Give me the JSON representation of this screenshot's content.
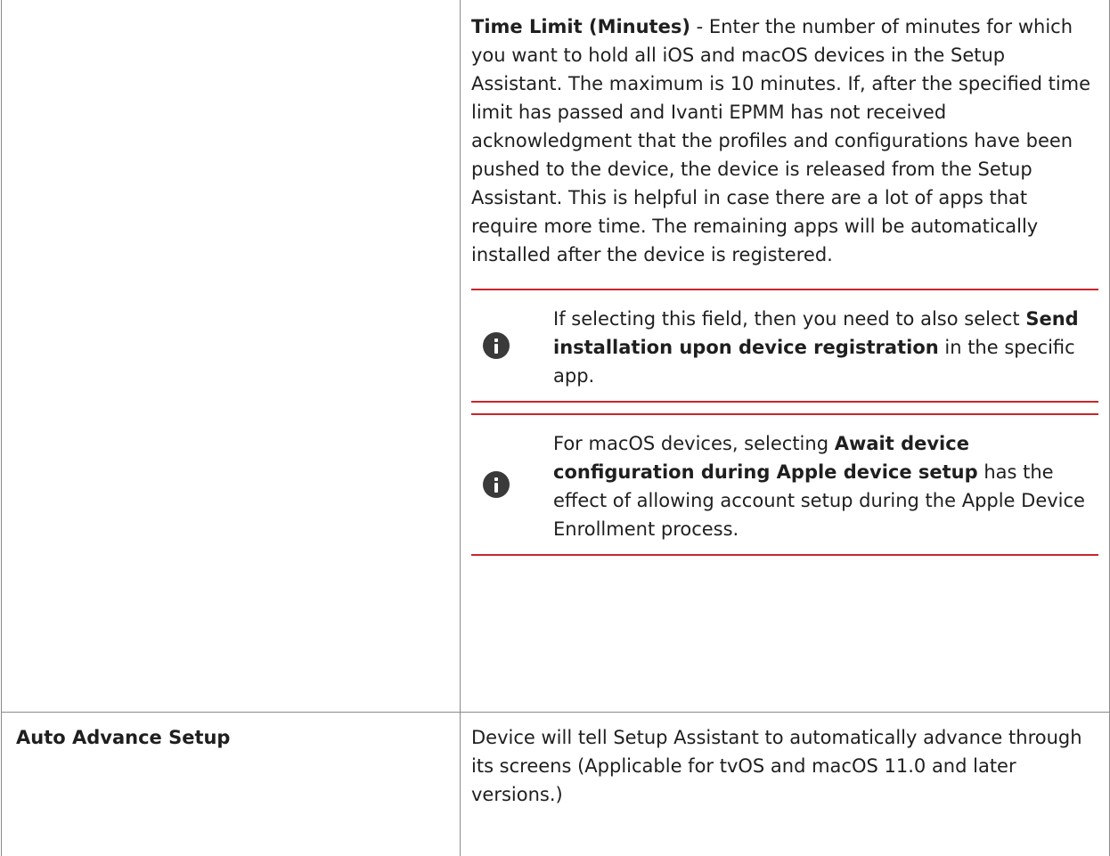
{
  "time_limit": {
    "term": "Time Limit (Minutes)",
    "description": " - Enter the number of minutes for which you want to hold all iOS and macOS devices in the Setup Assistant. The maximum is 10 minutes. If, after the specified time limit has passed and Ivanti EPMM has not received acknowledgment that the profiles and configurations have been pushed to the device, the device is released from the Setup Assistant. This is helpful in case there are a lot of apps that require more time. The remaining apps will be automatically installed after the device is registered."
  },
  "note_1": {
    "icon": "info-icon",
    "text_before": "If selecting this field, then you need to also select ",
    "bold": "Send installation upon device registration",
    "text_after": " in the specific app."
  },
  "note_2": {
    "icon": "info-icon",
    "text_before": "For macOS devices, selecting ",
    "bold": "Await device configuration during Apple device setup",
    "text_after": " has the effect of allowing account setup during the Apple Device Enrollment process."
  },
  "auto_advance": {
    "label": "Auto Advance Setup",
    "description": "Device will tell Setup Assistant to automatically advance through its screens (Applicable for tvOS and macOS 11.0 and later versions.)"
  },
  "colors": {
    "note_rule": "#c9252b",
    "border": "#8a8a8a",
    "icon": "#3a3a3a"
  }
}
